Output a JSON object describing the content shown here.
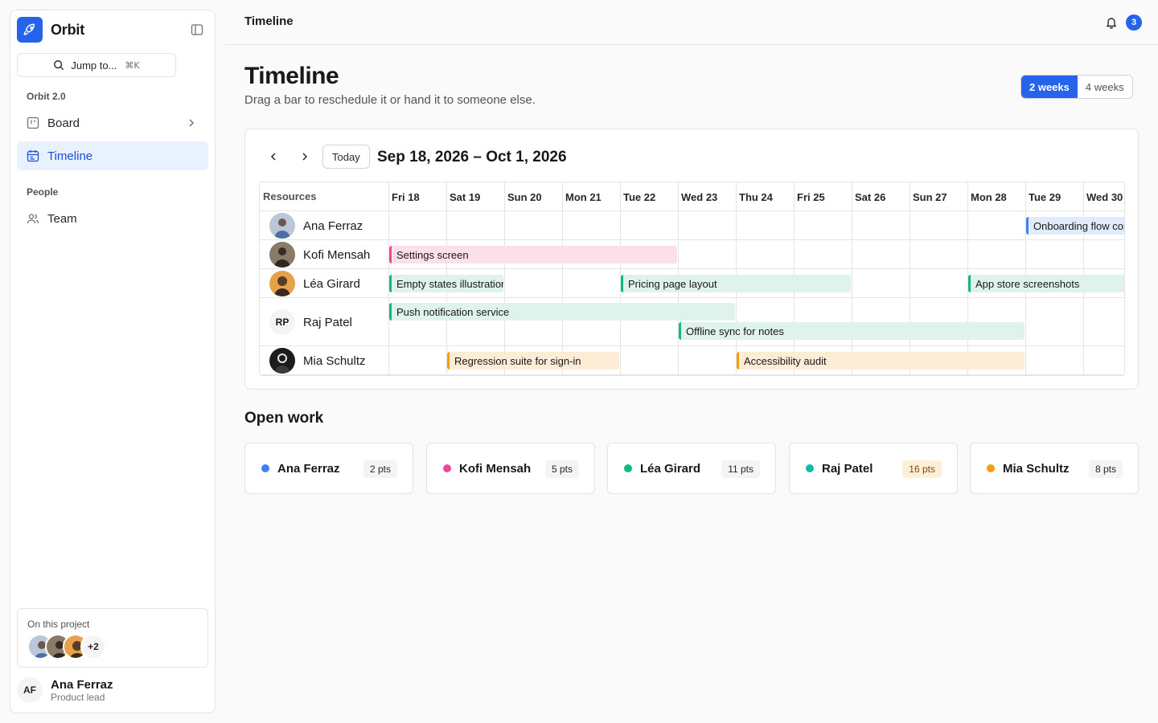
{
  "app": {
    "name": "Orbit"
  },
  "sidebar": {
    "search_label": "Jump to...",
    "search_shortcut": "⌘K",
    "groups": [
      {
        "label": "Orbit 2.0"
      },
      {
        "label": "People"
      }
    ],
    "items": [
      {
        "label": "Board"
      },
      {
        "label": "Timeline"
      },
      {
        "label": "Team"
      }
    ],
    "project": {
      "label": "On this project",
      "more": "+2"
    },
    "user": {
      "initials": "AF",
      "name": "Ana Ferraz",
      "role": "Product lead"
    }
  },
  "topbar": {
    "title": "Timeline",
    "notifications": "3"
  },
  "page": {
    "title": "Timeline",
    "subtitle": "Drag a bar to reschedule it or hand it to someone else.",
    "view_options": [
      "2 weeks",
      "4 weeks"
    ],
    "active_view": "2 weeks"
  },
  "timeline": {
    "today_label": "Today",
    "range": "Sep 18, 2026 – Oct 1, 2026",
    "resources_header": "Resources",
    "days": [
      "Fri 18",
      "Sat 19",
      "Sun 20",
      "Mon 21",
      "Tue 22",
      "Wed 23",
      "Thu 24",
      "Fri 25",
      "Sat 26",
      "Sun 27",
      "Mon 28",
      "Tue 29",
      "Wed 30"
    ],
    "resources": [
      {
        "name": "Ana Ferraz",
        "initials": ""
      },
      {
        "name": "Kofi Mensah",
        "initials": ""
      },
      {
        "name": "Léa Girard",
        "initials": ""
      },
      {
        "name": "Raj Patel",
        "initials": "RP"
      },
      {
        "name": "Mia Schultz",
        "initials": ""
      }
    ],
    "tasks": [
      {
        "label": "Onboarding flow copy",
        "resource": "Ana Ferraz",
        "start": "Tue 29",
        "end": "Wed 30",
        "color": "#3b82f6"
      },
      {
        "label": "Settings screen",
        "resource": "Kofi Mensah",
        "start": "Fri 18",
        "end": "Tue 22",
        "color": "#ec4899"
      },
      {
        "label": "Empty states illustrations",
        "resource": "Léa Girard",
        "start": "Fri 18",
        "end": "Sat 19",
        "color": "#10b981"
      },
      {
        "label": "Pricing page layout",
        "resource": "Léa Girard",
        "start": "Tue 22",
        "end": "Fri 25",
        "color": "#10b981"
      },
      {
        "label": "App store screenshots",
        "resource": "Léa Girard",
        "start": "Mon 28",
        "end": "Wed 30",
        "color": "#10b981"
      },
      {
        "label": "Push notification service",
        "resource": "Raj Patel",
        "start": "Fri 18",
        "end": "Wed 23",
        "color": "#10b981"
      },
      {
        "label": "Offline sync for notes",
        "resource": "Raj Patel",
        "start": "Wed 23",
        "end": "Mon 28",
        "color": "#10b981"
      },
      {
        "label": "Regression suite for sign-in",
        "resource": "Mia Schultz",
        "start": "Sat 19",
        "end": "Mon 21",
        "color": "#f59e0b"
      },
      {
        "label": "Accessibility audit",
        "resource": "Mia Schultz",
        "start": "Thu 24",
        "end": "Mon 28",
        "color": "#f59e0b"
      }
    ]
  },
  "open_work": {
    "title": "Open work",
    "people": [
      {
        "name": "Ana Ferraz",
        "points": "2 pts",
        "color": "#3b82f6"
      },
      {
        "name": "Kofi Mensah",
        "points": "5 pts",
        "color": "#ec4899"
      },
      {
        "name": "Léa Girard",
        "points": "11 pts",
        "color": "#10b981"
      },
      {
        "name": "Raj Patel",
        "points": "16 pts",
        "color": "#14b8a6"
      },
      {
        "name": "Mia Schultz",
        "points": "8 pts",
        "color": "#f59e0b"
      }
    ]
  }
}
